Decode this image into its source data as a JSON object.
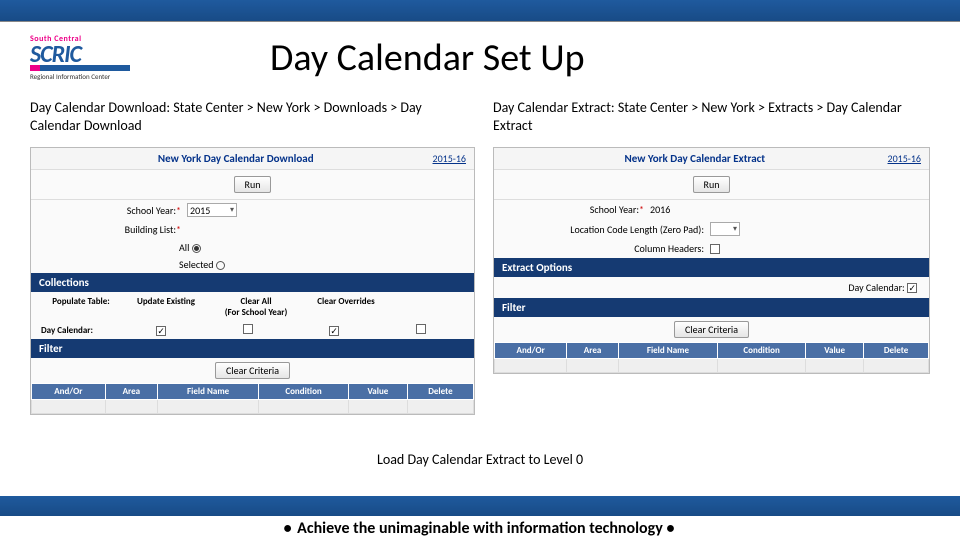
{
  "logo": {
    "top": "South Central",
    "main": "SCRIC",
    "sub": "Regional Information Center"
  },
  "title": "Day Calendar Set Up",
  "left": {
    "breadcrumb": "Day Calendar Download: State Center > New York > Downloads > Day Calendar Download",
    "panel_title": "New York Day Calendar Download",
    "year_link": "2015-16",
    "run": "Run",
    "school_year_label": "School Year:",
    "school_year_value": "2015",
    "building_list_label": "Building List:",
    "radio_all": "All",
    "radio_selected": "Selected",
    "collections": "Collections",
    "populate": "Populate Table:",
    "col_update": "Update Existing",
    "col_clear": "Clear All\n(For School Year)",
    "col_override": "Clear Overrides",
    "row_daycal": "Day Calendar:",
    "filter": "Filter",
    "clear_criteria": "Clear Criteria",
    "th1": "And/Or",
    "th2": "Area",
    "th3": "Field Name",
    "th4": "Condition",
    "th5": "Value",
    "th6": "Delete"
  },
  "right": {
    "breadcrumb": "Day Calendar Extract: State Center > New York > Extracts > Day Calendar Extract",
    "panel_title": "New York Day Calendar Extract",
    "year_link": "2015-16",
    "run": "Run",
    "school_year_label": "School Year:",
    "school_year_value": "2016",
    "loc_label": "Location Code Length (Zero Pad):",
    "col_headers_label": "Column Headers:",
    "extract_options": "Extract Options",
    "daycal_label": "Day Calendar:",
    "filter": "Filter",
    "clear_criteria": "Clear Criteria",
    "th1": "And/Or",
    "th2": "Area",
    "th3": "Field Name",
    "th4": "Condition",
    "th5": "Value",
    "th6": "Delete"
  },
  "load_text": "Load Day Calendar Extract to Level 0",
  "tagline": "Achieve the unimaginable with information technology"
}
